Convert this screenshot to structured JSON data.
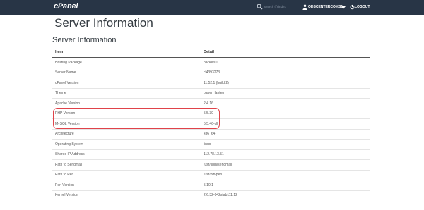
{
  "header": {
    "logo": "cPanel",
    "search": {
      "placeholder": "Search (/) index"
    },
    "user": {
      "name": "ODSCENTERCOMS1"
    },
    "logout_label": "LOGOUT",
    "colors": {
      "bar": "#283546"
    },
    "icons": [
      "search-icon",
      "user-icon",
      "chevron-down-icon",
      "logout-icon"
    ]
  },
  "page": {
    "title": "Server Information",
    "section_title": "Server Information"
  },
  "table": {
    "columns": [
      "Item",
      "Detail"
    ],
    "rows": [
      [
        "Hosting Package",
        "packet01"
      ],
      [
        "Server Name",
        "cl4393273"
      ],
      [
        "cPanel Version",
        "11.52.1 (build 2)"
      ],
      [
        "Theme",
        "paper_lantern"
      ],
      [
        "Apache Version",
        "2.4.16"
      ],
      [
        "PHP Version",
        "5.5.30"
      ],
      [
        "MySQL Version",
        "5.5.46-cll"
      ],
      [
        "Architecture",
        "x86_64"
      ],
      [
        "Operating System",
        "linux"
      ],
      [
        "Shared IP Address",
        "112.78.13.51"
      ],
      [
        "Path to Sendmail",
        "/usr/sbin/sendmail"
      ],
      [
        "Path to Perl",
        "/usr/bin/perl"
      ],
      [
        "Perl Version",
        "5.10.1"
      ],
      [
        "Kernel Version",
        "2.6.32-042stab111.12"
      ]
    ],
    "highlight_color": "#e0434a"
  }
}
